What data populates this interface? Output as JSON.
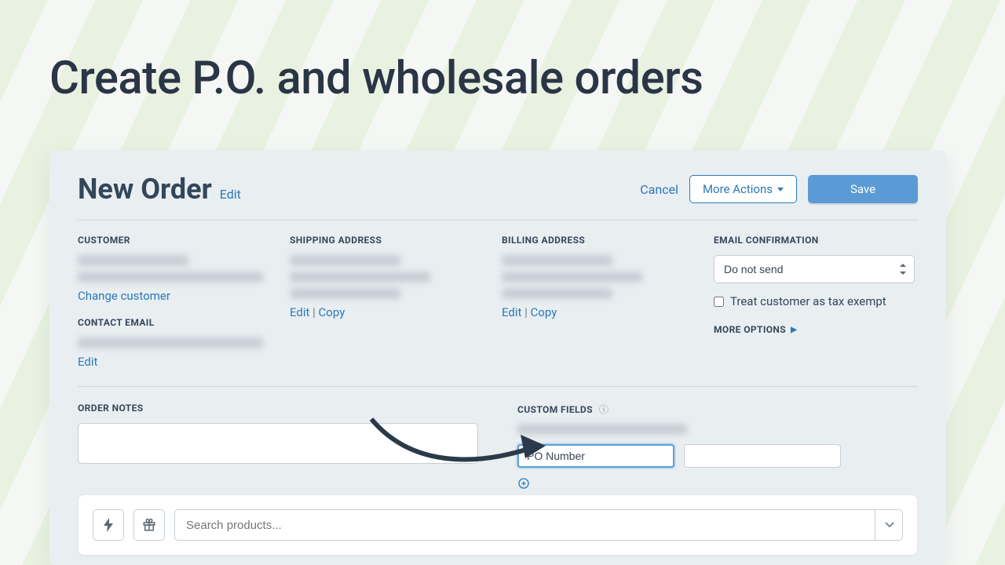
{
  "page_heading": "Create P.O. and wholesale orders",
  "header": {
    "title": "New Order",
    "edit_label": "Edit",
    "cancel_label": "Cancel",
    "more_actions_label": "More Actions",
    "save_label": "Save"
  },
  "sections": {
    "customer_label": "CUSTOMER",
    "change_customer": "Change customer",
    "contact_email_label": "CONTACT EMAIL",
    "contact_email_edit": "Edit",
    "shipping_label": "SHIPPING ADDRESS",
    "shipping_edit": "Edit",
    "shipping_copy": "Copy",
    "billing_label": "BILLING ADDRESS",
    "billing_edit": "Edit",
    "billing_copy": "Copy",
    "email_conf_label": "EMAIL CONFIRMATION",
    "email_conf_value": "Do not send",
    "tax_exempt_label": "Treat customer as tax exempt",
    "more_options_label": "MORE OPTIONS"
  },
  "notes": {
    "label": "ORDER NOTES"
  },
  "custom_fields": {
    "label": "CUSTOM FIELDS",
    "po_value": "PO Number",
    "second_value": ""
  },
  "products": {
    "search_placeholder": "Search products..."
  }
}
